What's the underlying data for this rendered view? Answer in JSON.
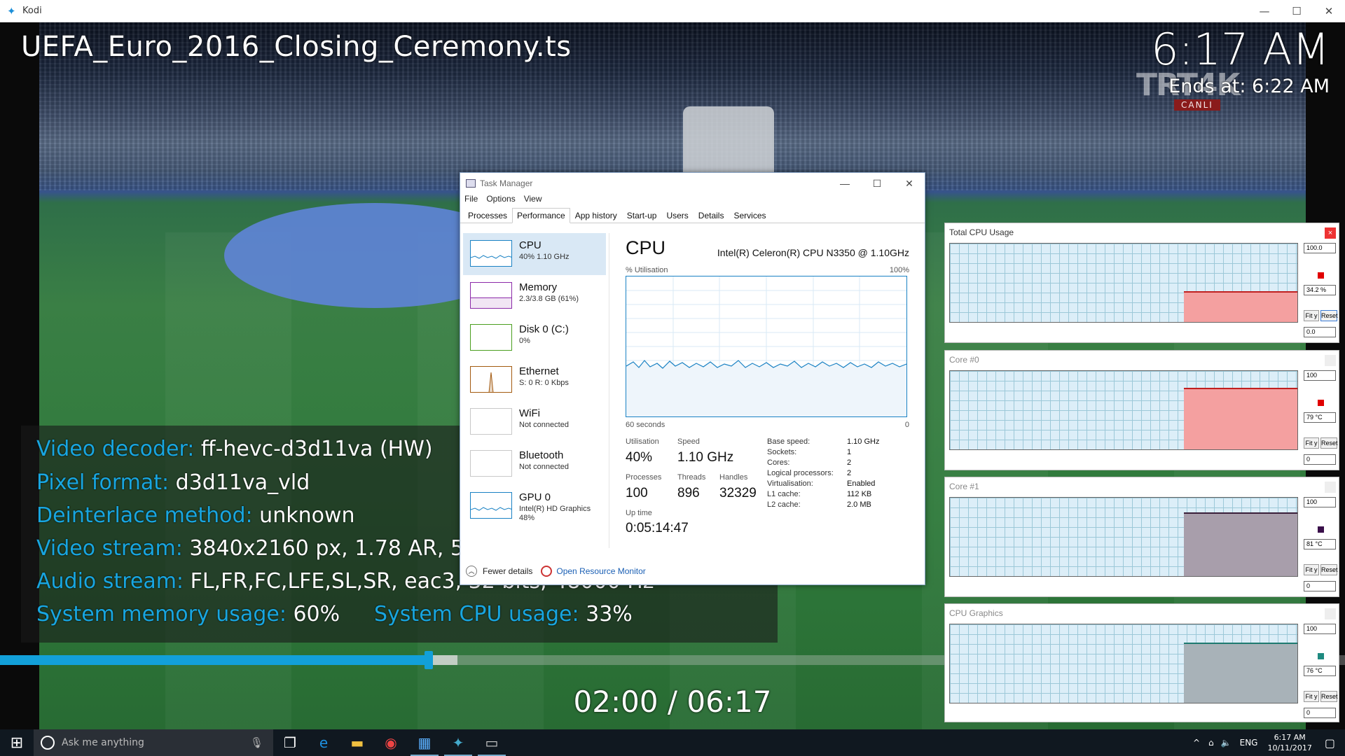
{
  "window": {
    "title": "Kodi"
  },
  "osd": {
    "title": "UEFA_Euro_2016_Closing_Ceremony.ts",
    "clock": "6:17 AM",
    "ends_at": "Ends at: 6:22 AM",
    "channel_logo": "TRT4K",
    "channel_sub": "CANLI",
    "time": "02:00 / 06:17",
    "progress_fraction": 0.319,
    "buffer_fraction": 0.34
  },
  "info": [
    {
      "key": "Video decoder:",
      "value": " ff-hevc-d3d11va (HW)"
    },
    {
      "key": "Pixel format:",
      "value": " d3d11va_vld"
    },
    {
      "key": "Deinterlace method:",
      "value": " unknown"
    },
    {
      "key": "Video stream:",
      "value": " 3840x2160 px, 1.78 AR, 50."
    },
    {
      "key": "Audio stream:",
      "value": " FL,FR,FC,LFE,SL,SR, eac3, 32 bits, 48000 Hz"
    },
    {
      "key": "System memory usage:",
      "value": " 60%"
    },
    {
      "key": "System CPU usage:",
      "value": " 33%"
    }
  ],
  "taskmgr": {
    "title": "Task Manager",
    "menu": [
      "File",
      "Options",
      "View"
    ],
    "tabs": [
      "Processes",
      "Performance",
      "App history",
      "Start-up",
      "Users",
      "Details",
      "Services"
    ],
    "sidebar": [
      {
        "name": "CPU",
        "sub1": "40%  1.10 GHz",
        "sub2": "",
        "color": "#1a82c4"
      },
      {
        "name": "Memory",
        "sub1": "2.3/3.8 GB (61%)",
        "sub2": "",
        "color": "#8b2aa8"
      },
      {
        "name": "Disk 0 (C:)",
        "sub1": "0%",
        "sub2": "",
        "color": "#4a9e1f"
      },
      {
        "name": "Ethernet",
        "sub1": "S: 0  R: 0 Kbps",
        "sub2": "",
        "color": "#a35a10"
      },
      {
        "name": "WiFi",
        "sub1": "Not connected",
        "sub2": "",
        "color": "#c8c8c8"
      },
      {
        "name": "Bluetooth",
        "sub1": "Not connected",
        "sub2": "",
        "color": "#c8c8c8"
      },
      {
        "name": "GPU 0",
        "sub1": "Intel(R) HD Graphics",
        "sub2": "48%",
        "color": "#1a82c4"
      }
    ],
    "cpu_heading": "CPU",
    "model": "Intel(R) Celeron(R) CPU N3350 @ 1.10GHz",
    "util_label": "% Utilisation",
    "util_max": "100%",
    "seconds": "60 seconds",
    "zero": "0",
    "stats": {
      "utilisation_label": "Utilisation",
      "utilisation": "40%",
      "speed_label": "Speed",
      "speed": "1.10 GHz",
      "processes_label": "Processes",
      "processes": "100",
      "threads_label": "Threads",
      "threads": "896",
      "handles_label": "Handles",
      "handles": "32329",
      "uptime_label": "Up time",
      "uptime": "0:05:14:47"
    },
    "specs": [
      {
        "label": "Base speed:",
        "value": "1.10 GHz"
      },
      {
        "label": "Sockets:",
        "value": "1"
      },
      {
        "label": "Cores:",
        "value": "2"
      },
      {
        "label": "Logical processors:",
        "value": "2"
      },
      {
        "label": "Virtualisation:",
        "value": "Enabled"
      },
      {
        "label": "L1 cache:",
        "value": "112 KB"
      },
      {
        "label": "L2 cache:",
        "value": "2.0 MB"
      }
    ],
    "fewer_details": "Fewer details",
    "open_resource_monitor": "Open Resource Monitor"
  },
  "meters": [
    {
      "title": "Total CPU Usage",
      "top": "100.0",
      "reading": "34.2 %",
      "bottom": "0.0",
      "fill": "#f4a0a0",
      "line": "#c02020",
      "sq": "#e00000",
      "level": 0.38
    },
    {
      "title": "Core #0",
      "top": "100",
      "reading": "79 °C",
      "bottom": "0",
      "fill": "#f4a0a0",
      "line": "#c02020",
      "sq": "#e00000",
      "level": 0.78
    },
    {
      "title": "Core #1",
      "top": "100",
      "reading": "81 °C",
      "bottom": "0",
      "fill": "#a89eab",
      "line": "#3a1f3a",
      "sq": "#3a0f4a",
      "level": 0.8
    },
    {
      "title": "CPU Graphics",
      "top": "100",
      "reading": "76 °C",
      "bottom": "0",
      "fill": "#a8b2b8",
      "line": "#1e7a70",
      "sq": "#1e8a80",
      "level": 0.76
    }
  ],
  "meter_buttons": {
    "fit": "Fit y",
    "reset": "Reset"
  },
  "taskbar": {
    "search_placeholder": "Ask me anything",
    "lang": "ENG",
    "time": "6:17 AM",
    "date": "10/11/2017"
  }
}
